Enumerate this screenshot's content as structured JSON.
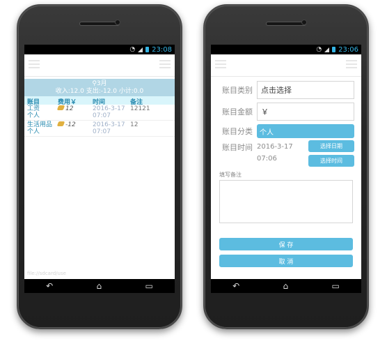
{
  "left": {
    "status_time": "23:08",
    "summary": {
      "month": "3月",
      "totals": "收入:12.0 支出:-12.0 小计:0.0"
    },
    "table": {
      "headers": [
        "账目",
        "费用￥",
        "时间",
        "备注"
      ],
      "rows": [
        {
          "name": "工资",
          "category": "个人",
          "amount": "12",
          "date": "2016-3-17",
          "time": "07:07",
          "note": "12121"
        },
        {
          "name": "生活用品",
          "category": "个人",
          "amount": "-12",
          "date": "2016-3-17",
          "time": "07:07",
          "note": "12"
        }
      ]
    },
    "watermark": "file://sdcard/use"
  },
  "right": {
    "status_time": "23:06",
    "form": {
      "type_label": "账目类别",
      "type_value": "点击选择",
      "amount_label": "账目金额",
      "amount_value": "￥",
      "category_label": "账目分类",
      "category_value": "个人",
      "time_label": "账目时间",
      "date_value": "2016-3-17",
      "time_value": "07:06",
      "pick_date": "选择日期",
      "pick_time": "选择时间",
      "note_label": "填写备注",
      "save": "保 存",
      "cancel": "取 消"
    }
  },
  "colors": {
    "accent": "#5cbce0",
    "summary_bg": "#b1d6e5",
    "status_accent": "#35b5e5"
  }
}
